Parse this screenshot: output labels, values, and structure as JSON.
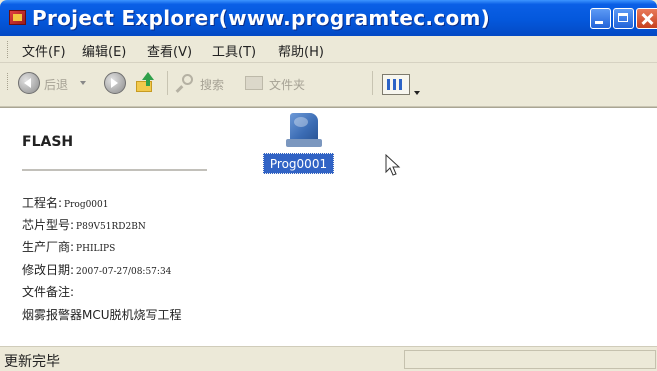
{
  "window": {
    "title": "Project Explorer(www.programtec.com)"
  },
  "menu": {
    "items": [
      "文件(F)",
      "编辑(E)",
      "查看(V)",
      "工具(T)",
      "帮助(H)"
    ]
  },
  "toolbar": {
    "back_label": "后退",
    "search_label": "搜索",
    "folders_label": "文件夹"
  },
  "panel": {
    "title": "FLASH",
    "properties": [
      {
        "key": "工程名:",
        "value": "Prog0001"
      },
      {
        "key": "芯片型号:",
        "value": "P89V51RD2BN"
      },
      {
        "key": "生产厂商:",
        "value": "PHILIPS"
      },
      {
        "key": "修改日期:",
        "value": "2007-07-27/08:57:34"
      },
      {
        "key": "文件备注:",
        "value": ""
      },
      {
        "key": "",
        "value": "烟雾报警器MCU脱机烧写工程"
      }
    ]
  },
  "file": {
    "label": "Prog0001"
  },
  "status": {
    "text": "更新完毕"
  },
  "colors": {
    "title_bar": "#0458dc",
    "selection": "#3163c5",
    "chrome": "#ece9d8"
  }
}
